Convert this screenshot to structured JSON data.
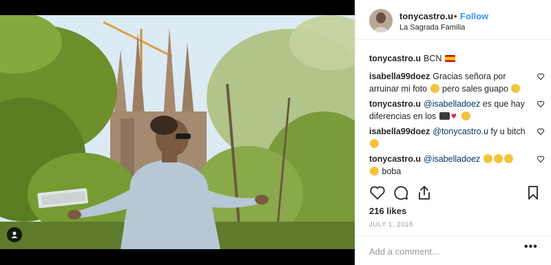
{
  "header": {
    "username": "tonycastro.u",
    "separator": "•",
    "follow_label": "Follow",
    "location": "La Sagrada Familia"
  },
  "caption": {
    "username": "tonycastro.u",
    "text": "BCN"
  },
  "comments": [
    {
      "username": "isabella99doez",
      "text": "Gracias señora por arruinar mi foto",
      "text2": "pero sales guapo"
    },
    {
      "username": "tonycastro.u",
      "mention": "@isabelladoez",
      "text": "es que hay diferencias en los"
    },
    {
      "username": "isabella99doez",
      "mention": "@tonycastro.u",
      "text": "fy u bitch"
    },
    {
      "username": "tonycastro.u",
      "mention": "@isabelladoez",
      "text": "boba"
    }
  ],
  "likes": "216 likes",
  "date": "JULY 1, 2018",
  "add_comment": {
    "placeholder": "Add a comment..."
  },
  "more_label": "•••",
  "icons": [
    "like-heart-icon",
    "comment-icon",
    "share-icon",
    "save-bookmark-icon",
    "user-tag-icon"
  ],
  "colors": {
    "follow": "#3897f0",
    "text": "#262626",
    "muted": "#999999",
    "mention": "#003569"
  }
}
